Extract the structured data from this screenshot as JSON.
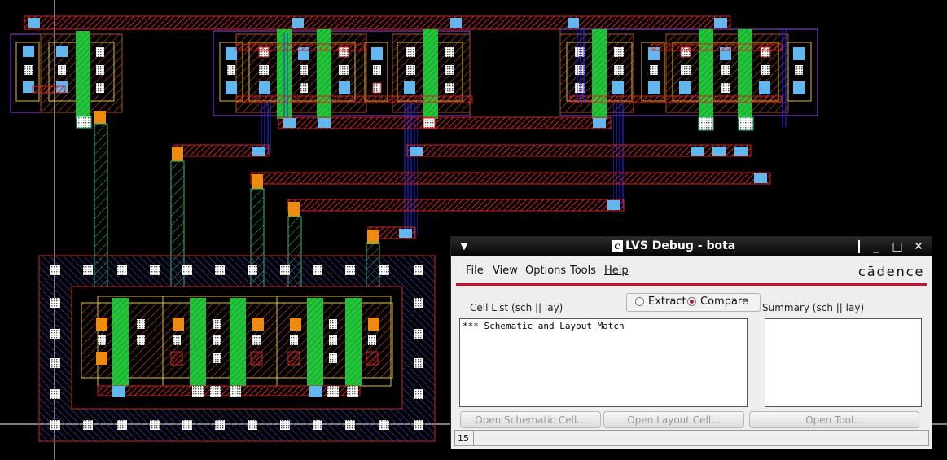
{
  "colors": {
    "background": "#000000",
    "metal1": "#d42020",
    "poly": "#22c43a",
    "diffusion": "#c05030",
    "nwell": "#3a3aa8",
    "contact": "#62b8ee",
    "via": "#ee8a10",
    "metal2": "#2b2bff",
    "outline": "#9944ee",
    "implant": "#e0c020",
    "accent_red": "#c8102e"
  },
  "lvs_window": {
    "title": "LVS Debug - bota",
    "window_icon_letter": "c",
    "menus": [
      "File",
      "View",
      "Options",
      "Tools",
      "Help"
    ],
    "logo": "cādence",
    "mode_options": [
      {
        "label": "Extract",
        "checked": false
      },
      {
        "label": "Compare",
        "checked": true
      }
    ],
    "cell_list_label": "Cell List (sch || lay)",
    "cell_list_items": [
      "*** Schematic and Layout Match"
    ],
    "summary_label": "Summary (sch || lay)",
    "buttons": [
      "Open Schematic Cell...",
      "Open Layout Cell...",
      "Open Tool..."
    ],
    "status_value": "15",
    "controls": {
      "menu": "▼",
      "minimize": "_",
      "maximize": "□",
      "close": "✕"
    }
  }
}
